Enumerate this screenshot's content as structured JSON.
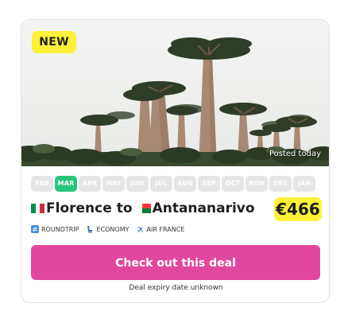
{
  "badge": {
    "label": "NEW"
  },
  "photo": {
    "posted": "Posted today"
  },
  "months": [
    {
      "label": "FEB",
      "active": false
    },
    {
      "label": "MAR",
      "active": true
    },
    {
      "label": "APR",
      "active": false
    },
    {
      "label": "MAY",
      "active": false
    },
    {
      "label": "JUN",
      "active": false
    },
    {
      "label": "JUL",
      "active": false
    },
    {
      "label": "AUG",
      "active": false
    },
    {
      "label": "SEP",
      "active": false
    },
    {
      "label": "OCT",
      "active": false
    },
    {
      "label": "NOV",
      "active": false
    },
    {
      "label": "DEC",
      "active": false
    },
    {
      "label": "JAN",
      "active": false
    }
  ],
  "route": {
    "origin": "Florence",
    "separator": "to",
    "destination": "Antananarivo",
    "origin_flag": "italy-flag-icon",
    "destination_flag": "madagascar-flag-icon"
  },
  "price": {
    "label": "€466"
  },
  "tags": [
    {
      "icon": "roundtrip-icon",
      "label": "ROUNDTRIP"
    },
    {
      "icon": "seat-icon",
      "label": "ECONOMY"
    },
    {
      "icon": "airplane-icon",
      "label": "AIR FRANCE"
    }
  ],
  "cta": {
    "label": "Check out this deal"
  },
  "expiry": {
    "label": "Deal expiry date unknown"
  },
  "colors": {
    "badge": "#fdf13a",
    "active_month": "#27c67a",
    "inactive_month": "#e6e6e6",
    "cta": "#e2479f"
  }
}
